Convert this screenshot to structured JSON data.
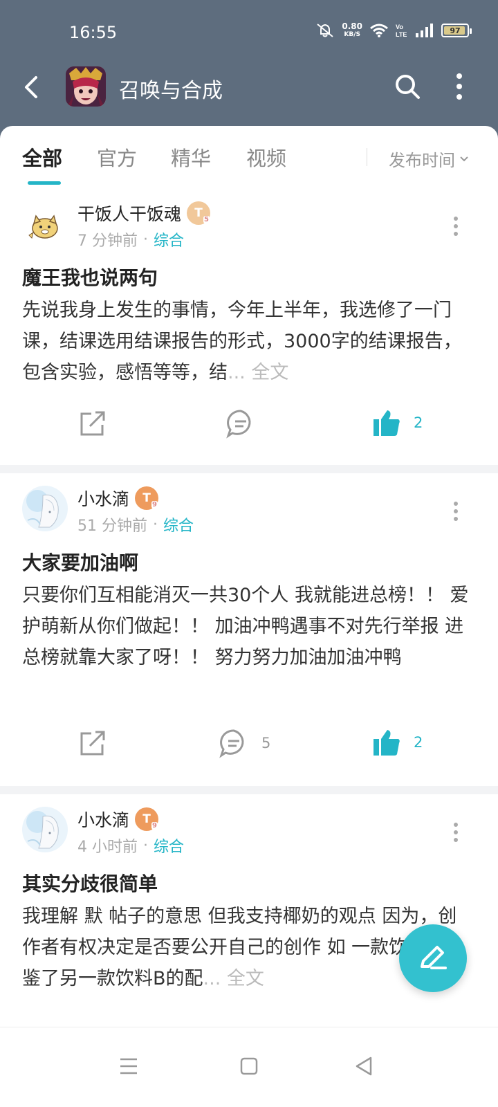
{
  "status_bar": {
    "time": "16:55",
    "net_speed_value": "0.80",
    "net_speed_unit": "KB/S",
    "battery": "97"
  },
  "app_bar": {
    "title": "召唤与合成"
  },
  "tabs": {
    "items": [
      "全部",
      "官方",
      "精华",
      "视频"
    ],
    "active_index": 0,
    "sort_label": "发布时间"
  },
  "posts": [
    {
      "author": "干饭人干饭魂",
      "badge": "T",
      "badge_level": "5",
      "time": "7 分钟前",
      "category": "综合",
      "title": "魔王我也说两句",
      "body": "先说我身上发生的事情，今年上半年，我选修了一门课，结课选用结课报告的形式，3000字的结课报告，包含实验，感悟等等，结",
      "more_label": "... 全文",
      "comments": "",
      "likes": "2"
    },
    {
      "author": "小水滴",
      "badge": "T",
      "badge_level": "9",
      "time": "51 分钟前",
      "category": "综合",
      "title": "大家要加油啊",
      "body": "只要你们互相能消灭一共30个人 我就能进总榜！！ 爱护萌新从你们做起！！ 加油冲鸭遇事不对先行举报 进总榜就靠大家了呀！！ 努力努力加油加油冲鸭",
      "more_label": "",
      "comments": "5",
      "likes": "2"
    },
    {
      "author": "小水滴",
      "badge": "T",
      "badge_level": "9",
      "time": "4 小时前",
      "category": "综合",
      "title": "其实分歧很简单",
      "body": "我理解 默 帖子的意思 但我支持椰奶的观点 因为，创作者有权决定是否要公开自己的创作 如 一款饮料A借鉴了另一款饮料B的配",
      "more_label": "... 全文",
      "comments": "",
      "likes": ""
    }
  ],
  "colors": {
    "header_bg": "#5e6d7e",
    "accent": "#24b5c7",
    "fab": "#33c1cf"
  },
  "icons": [
    "back-icon",
    "search-icon",
    "more-icon",
    "share-icon",
    "comment-icon",
    "like-icon",
    "edit-icon"
  ]
}
